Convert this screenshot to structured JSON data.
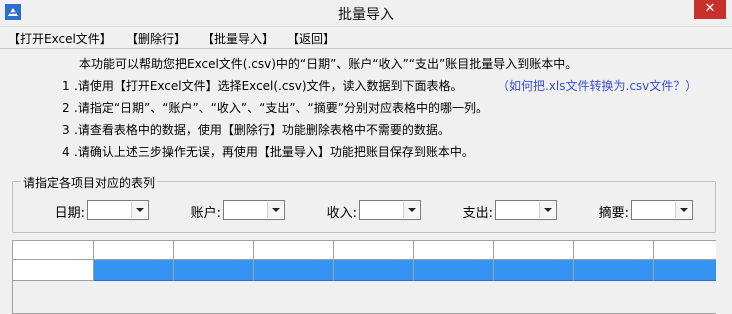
{
  "window": {
    "title": "批量导入",
    "close_glyph": "✕",
    "icon": "app-logo-icon"
  },
  "menu": [
    {
      "label": "【打开Excel文件】"
    },
    {
      "label": "【删除行】"
    },
    {
      "label": "【批量导入】"
    },
    {
      "label": "【返回】"
    }
  ],
  "instructions": {
    "intro": "本功能可以帮助您把Excel文件(.csv)中的“日期”、账户“收入”“支出”账目批量导入到账本中。",
    "steps": [
      {
        "num": "1",
        "text": ".请使用【打开Excel文件】选择Excel(.csv)文件，读入数据到下面表格。"
      },
      {
        "num": "2",
        "text": ".请指定“日期”、“账户”、“收入”、“支出”、“摘要”分别对应表格中的哪一列。"
      },
      {
        "num": "3",
        "text": ".请查看表格中的数据，使用【删除行】功能删除表格中不需要的数据。"
      },
      {
        "num": "4",
        "text": ".请确认上述三步操作无误，再使用【批量导入】功能把账目保存到账本中。"
      }
    ],
    "convert_link": "（如何把.xls文件转换为.csv文件？）"
  },
  "mapping": {
    "legend": "请指定各项目对应的表列",
    "fields": [
      {
        "label": "日期:",
        "value": ""
      },
      {
        "label": "账户:",
        "value": ""
      },
      {
        "label": "收入:",
        "value": ""
      },
      {
        "label": "支出:",
        "value": ""
      },
      {
        "label": "摘要:",
        "value": ""
      }
    ]
  },
  "colors": {
    "selection": "#3593f2",
    "link": "#3c4fd4",
    "close": "#c8312b"
  }
}
